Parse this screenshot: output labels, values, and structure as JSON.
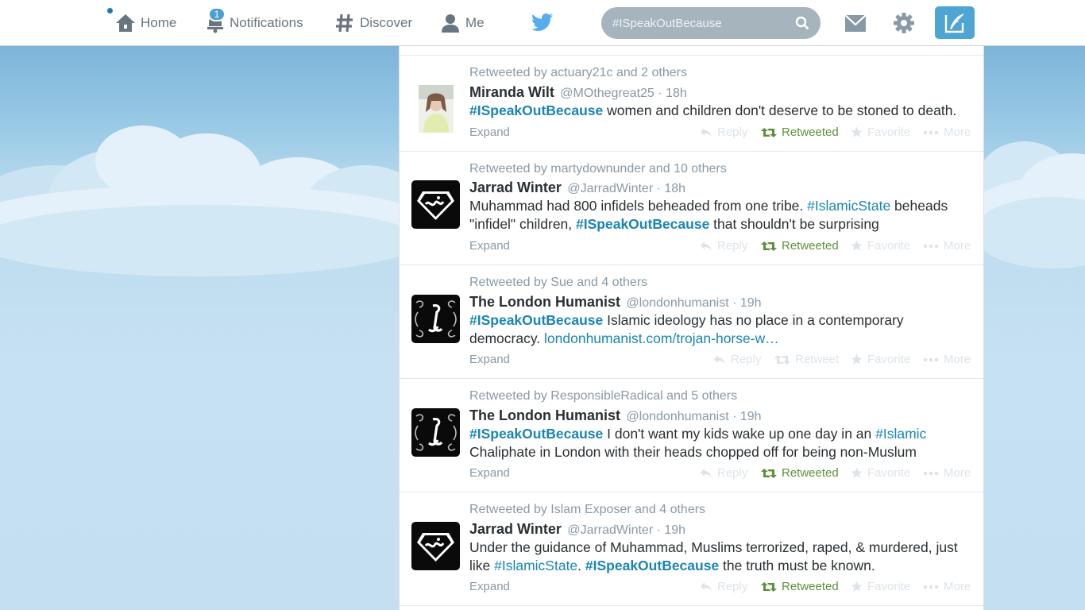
{
  "nav": {
    "home": "Home",
    "notifications": "Notifications",
    "notifications_count": "1",
    "discover": "Discover",
    "me": "Me"
  },
  "search": {
    "placeholder": "#ISpeakOutBecause"
  },
  "actions": {
    "expand": "Expand",
    "reply": "Reply",
    "retweeted": "Retweeted",
    "retweet": "Retweet",
    "favorite": "Favorite",
    "more": "More"
  },
  "tweets": [
    {
      "retweeted_by": "Retweeted by actuary21c and 2 others",
      "fullname": "Miranda Wilt",
      "handle": "@MOthegreat25",
      "time": "· 18h",
      "t1": "#ISpeakOutBecause",
      "t2": " women and children don't deserve to be stoned to death."
    },
    {
      "retweeted_by": "Retweeted by martydownunder and 10 others",
      "fullname": "Jarrad Winter",
      "handle": "@JarradWinter",
      "time": "· 18h",
      "t1": "Muhammad had 800 infidels beheaded from one tribe. ",
      "t2": "#IslamicState",
      "t3": " beheads \"infidel\" children, ",
      "t4": "#ISpeakOutBecause",
      "t5": " that shouldn't be surprising"
    },
    {
      "retweeted_by": "Retweeted by Sue and 4 others",
      "fullname": "The London Humanist",
      "handle": "@londonhumanist",
      "time": "· 19h",
      "t1": "#ISpeakOutBecause",
      "t2": " Islamic ideology has no place in a contemporary democracy. ",
      "t3": "londonhumanist.com/trojan-horse-w…"
    },
    {
      "retweeted_by": "Retweeted by ResponsibleRadical and 5 others",
      "fullname": "The London Humanist",
      "handle": "@londonhumanist",
      "time": "· 19h",
      "t1": "#ISpeakOutBecause",
      "t2": " I don't want my kids wake up one day in an ",
      "t3": "#Islamic",
      "t4": " Chaliphate in London with their heads chopped off for being non-Muslum"
    },
    {
      "retweeted_by": "Retweeted by Islam Exposer and 4 others",
      "fullname": "Jarrad Winter",
      "handle": "@JarradWinter",
      "time": "· 19h",
      "t1": "Under the guidance of Muhammad, Muslims terrorized, raped, & murdered, just like ",
      "t2": "#IslamicState",
      "t3": ". ",
      "t4": "#ISpeakOutBecause",
      "t5": " the truth must be known."
    }
  ],
  "colors": {
    "accent": "#1a84b3",
    "retweeted": "#5c913b",
    "muted": "#8899a6",
    "compose": "#4ea4d3"
  }
}
